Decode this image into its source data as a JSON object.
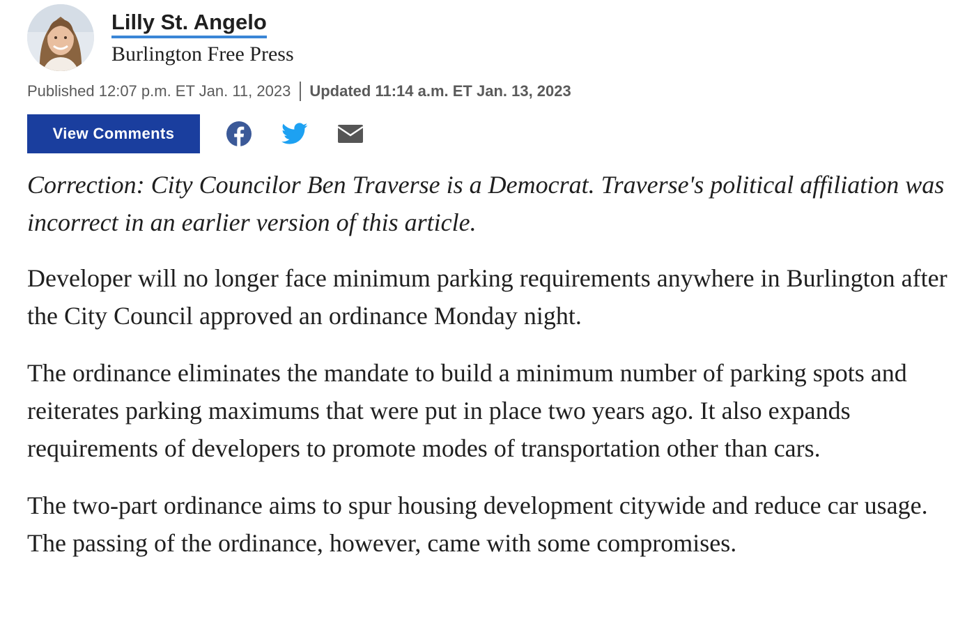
{
  "author": {
    "name": "Lilly St. Angelo",
    "publisher": "Burlington Free Press"
  },
  "dates": {
    "published": "Published 12:07 p.m. ET Jan. 11, 2023",
    "updated": "Updated 11:14 a.m. ET Jan. 13, 2023"
  },
  "actions": {
    "view_comments": "View Comments",
    "share_icons": [
      "facebook-icon",
      "twitter-icon",
      "email-icon"
    ]
  },
  "colors": {
    "button_bg": "#1a3e9e",
    "link_underline": "#3a86d6",
    "facebook": "#3b5998",
    "twitter": "#1da1f2",
    "email": "#555555"
  },
  "article": {
    "correction": "Correction: City Councilor Ben Traverse is a Democrat. Traverse's political affiliation was incorrect in an earlier version of this article.",
    "paragraphs": [
      "Developer will no longer face minimum parking requirements anywhere in Burlington after the City Council approved an ordinance Monday night.",
      "The ordinance eliminates the mandate to build a minimum number of parking spots and reiterates parking maximums that were put in place two years ago. It also expands requirements of developers to promote modes of transportation other than cars.",
      "The two-part ordinance aims to spur housing development citywide and reduce car usage. The passing of the ordinance, however, came with some compromises."
    ]
  }
}
